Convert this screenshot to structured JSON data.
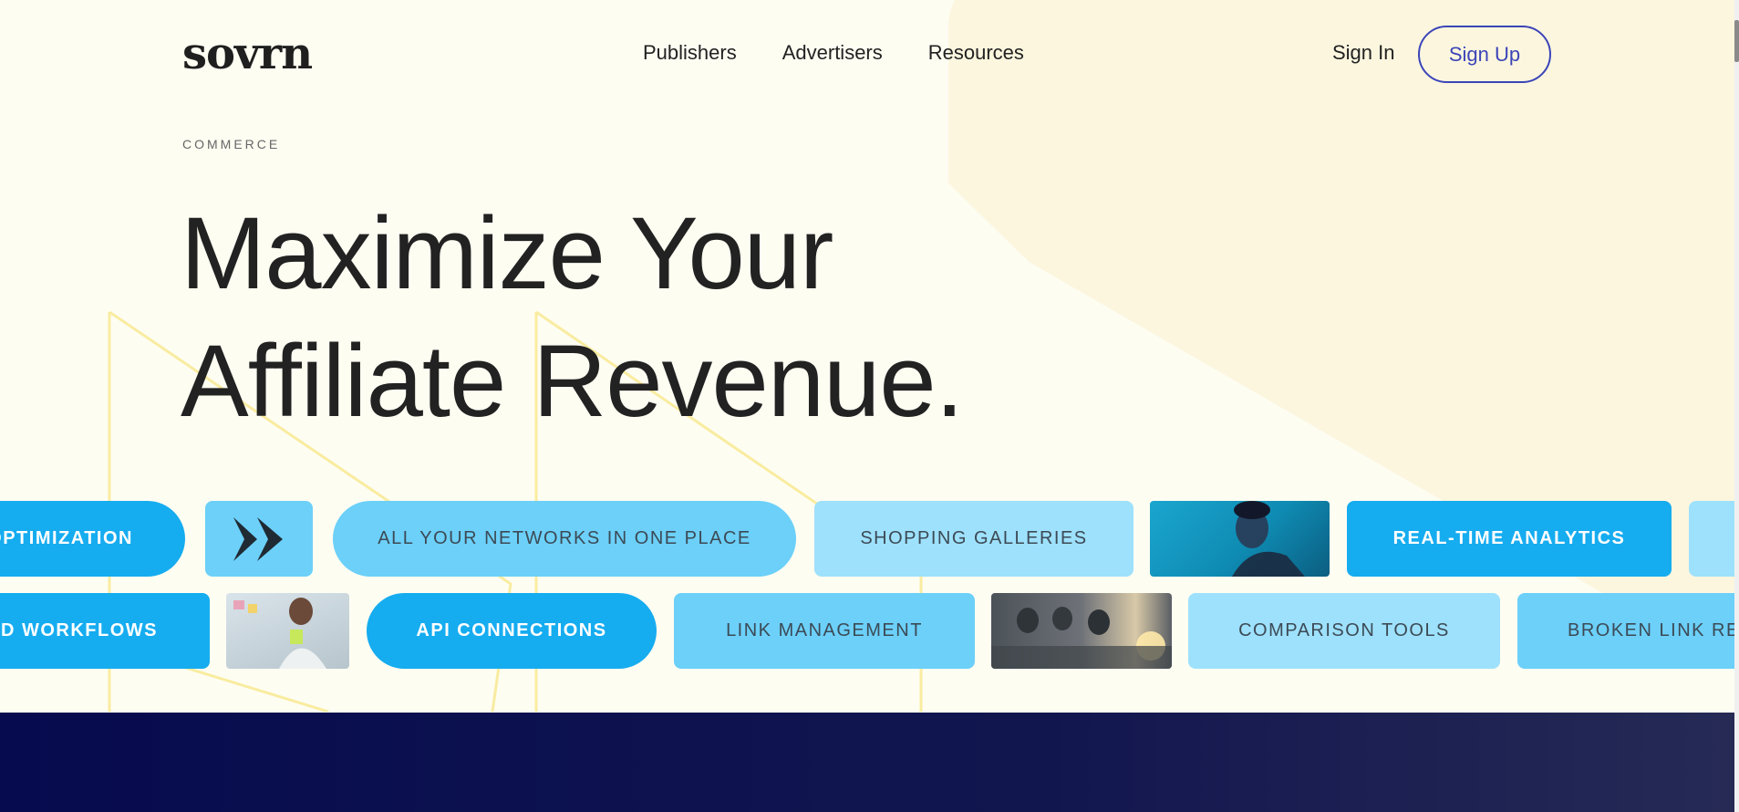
{
  "header": {
    "logo": "sovrn",
    "nav": [
      "Publishers",
      "Advertisers",
      "Resources"
    ],
    "sign_in": "Sign In",
    "sign_up": "Sign Up"
  },
  "hero": {
    "eyebrow": "COMMERCE",
    "title_line1": "Maximize Your",
    "title_line2": "Affiliate Revenue."
  },
  "pills_row1": [
    "OPTIMIZATION",
    "ALL YOUR NETWORKS IN ONE PLACE",
    "SHOPPING GALLERIES",
    "REAL-TIME ANALYTICS"
  ],
  "pills_row2": [
    "ED WORKFLOWS",
    "API CONNECTIONS",
    "LINK MANAGEMENT",
    "COMPARISON TOOLS",
    "BROKEN LINK RE"
  ],
  "colors": {
    "background": "#fefdf2",
    "accent": "#3b45b8",
    "pill_bright": "#16acf0",
    "pill_mid": "#6cd0f9",
    "pill_light": "#9ee1fc",
    "dark_band": "#060b4f"
  }
}
